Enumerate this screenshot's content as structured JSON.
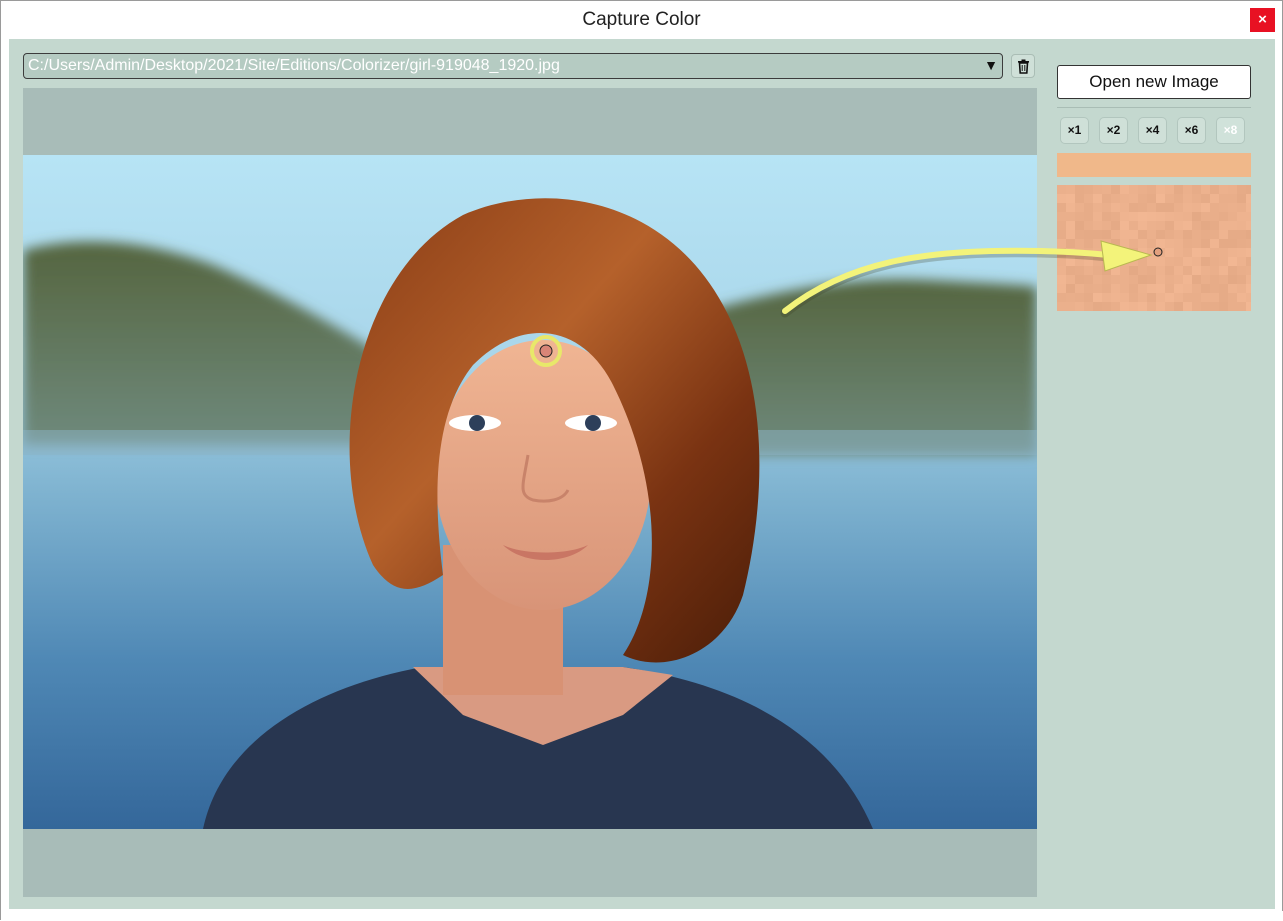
{
  "window": {
    "title": "Capture Color",
    "close_label": "×"
  },
  "toolbar": {
    "path_value": "C:/Users/Admin/Desktop/2021/Site/Editions/Colorizer/girl-919048_1920.jpg",
    "dropdown_arrow": "▼",
    "clear_icon": "trash-icon"
  },
  "side_panel": {
    "open_button_label": "Open new Image",
    "zoom_levels": [
      "×1",
      "×2",
      "×4",
      "×6",
      "×8"
    ],
    "active_zoom": "×8",
    "captured_color": "#f0b88a",
    "magnifier_base_color": "#ebb08c"
  },
  "colors": {
    "client_background": "#c4d8cf",
    "image_area_background": "#a8bcb8",
    "close_button": "#e81123",
    "annotation_arrow": "#f3f37a",
    "picker_ring": "#e8e86a"
  }
}
